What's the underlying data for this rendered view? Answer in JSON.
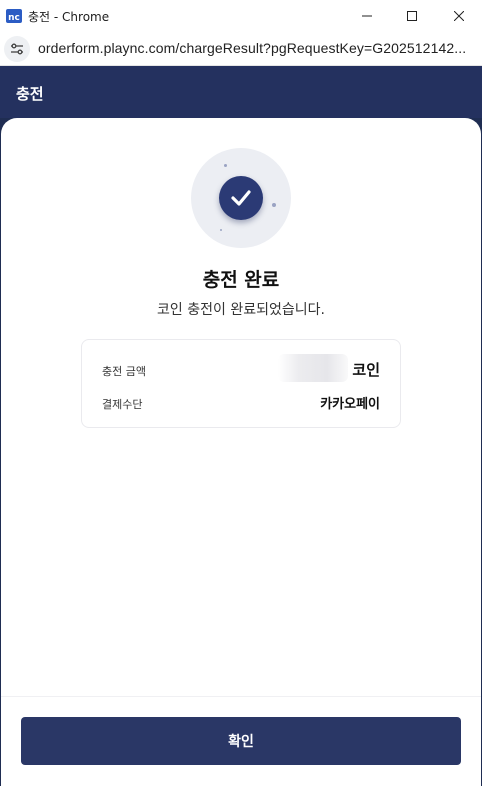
{
  "window": {
    "title": "충전 - Chrome",
    "logo_icon": "nc-logo-icon",
    "minimize_icon": "minimize-icon",
    "maximize_icon": "maximize-icon",
    "close_icon": "close-icon"
  },
  "address_bar": {
    "url": "orderform.plaync.com/chargeResult?pgRequestKey=G202512142...",
    "site_settings_icon": "tune-icon"
  },
  "header": {
    "title": "충전"
  },
  "result": {
    "icon": "check-circle-icon",
    "title": "충전 완료",
    "subtitle": "코인 충전이 완료되었습니다."
  },
  "details": {
    "rows": [
      {
        "label": "충전 금액",
        "value": "코인"
      },
      {
        "label": "결제수단",
        "value": "카카오페이"
      }
    ]
  },
  "footer": {
    "confirm_label": "확인"
  },
  "colors": {
    "brand_navy": "#24315f",
    "button": "#2a3766",
    "check_circle": "#2b3a75"
  }
}
